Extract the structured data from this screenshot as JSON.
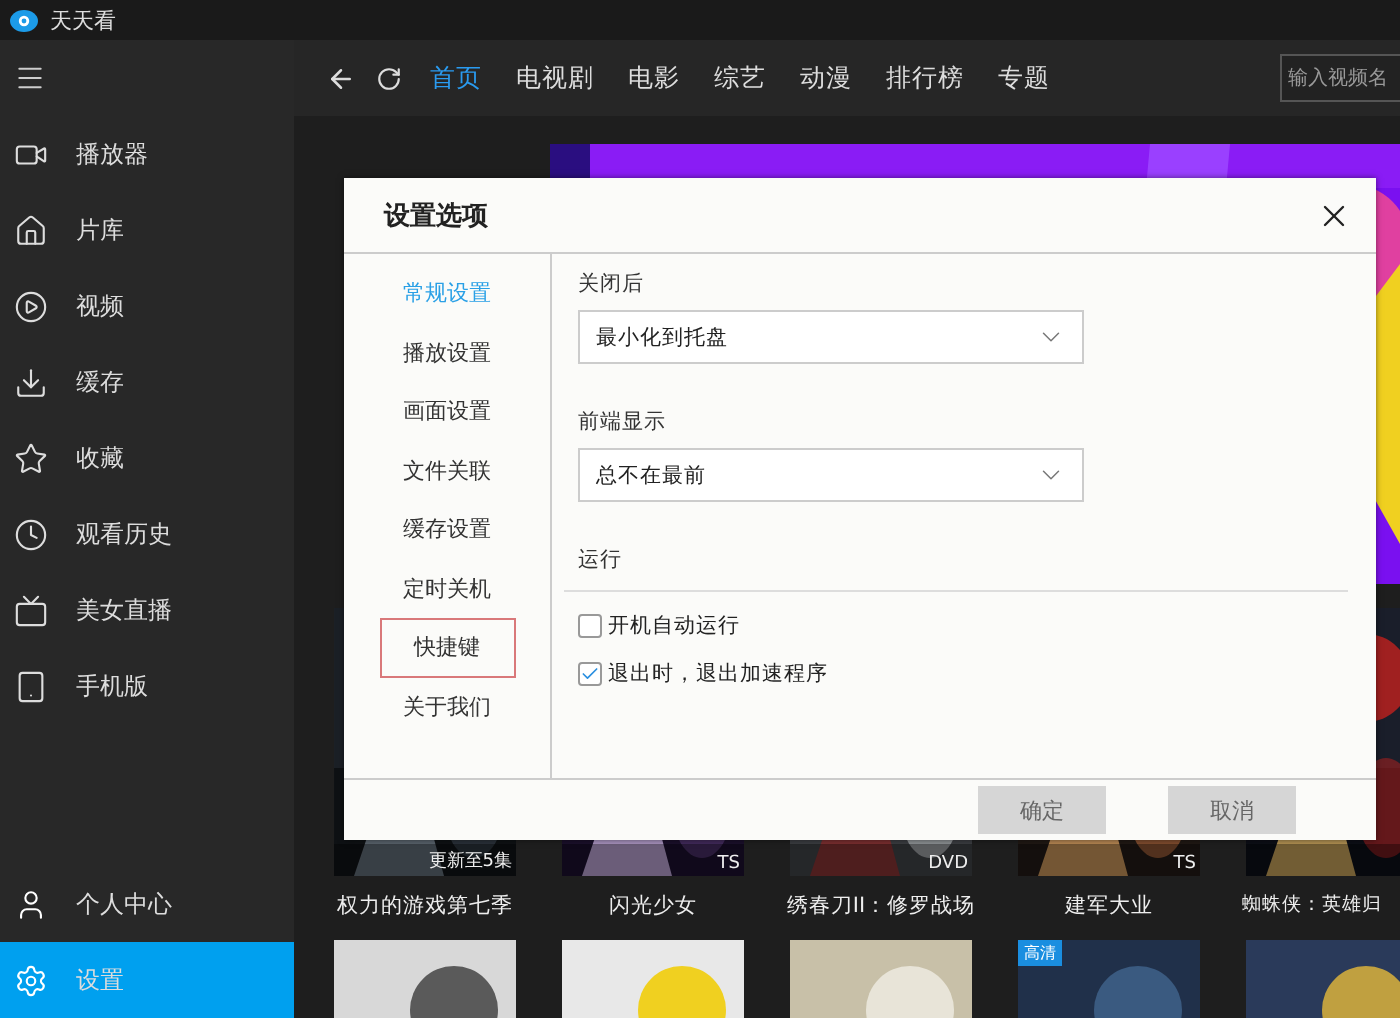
{
  "app": {
    "title": "天天看"
  },
  "sidebar": {
    "items": [
      {
        "label": "播放器",
        "selected": false
      },
      {
        "label": "片库",
        "selected": false
      },
      {
        "label": "视频",
        "selected": false
      },
      {
        "label": "缓存",
        "selected": false
      },
      {
        "label": "收藏",
        "selected": false
      },
      {
        "label": "观看历史",
        "selected": false
      },
      {
        "label": "美女直播",
        "selected": false
      },
      {
        "label": "手机版",
        "selected": false
      }
    ],
    "bottom_items": [
      {
        "label": "个人中心",
        "selected": false
      },
      {
        "label": "设置",
        "selected": true
      }
    ]
  },
  "nav": {
    "tabs": [
      {
        "label": "首页",
        "selected": true
      },
      {
        "label": "电视剧",
        "selected": false
      },
      {
        "label": "电影",
        "selected": false
      },
      {
        "label": "综艺",
        "selected": false
      },
      {
        "label": "动漫",
        "selected": false
      },
      {
        "label": "排行榜",
        "selected": false
      },
      {
        "label": "专题",
        "selected": false
      }
    ],
    "search": {
      "placeholder": "输入视频名"
    }
  },
  "posters": [
    {
      "title": "权力的游戏第七季",
      "tag": "更新至5集"
    },
    {
      "title": "闪光少女",
      "tag": "TS"
    },
    {
      "title": "绣春刀II：修罗战场",
      "tag": "DVD"
    },
    {
      "title": "建军大业",
      "tag": "TS"
    },
    {
      "title": "蜘蛛侠：英雄归"
    }
  ],
  "posters_row_2": [
    {
      "kind": "picture"
    },
    {
      "kind": "picture"
    },
    {
      "kind": "picture"
    },
    {
      "kind": "picture",
      "badge": "高清"
    },
    {
      "kind": "picture"
    }
  ],
  "dialog": {
    "title": "设置选项",
    "nav": [
      {
        "label": "常规设置",
        "selected": true,
        "focused": false
      },
      {
        "label": "播放设置",
        "selected": false,
        "focused": false
      },
      {
        "label": "画面设置",
        "selected": false,
        "focused": false
      },
      {
        "label": "文件关联",
        "selected": false,
        "focused": false
      },
      {
        "label": "缓存设置",
        "selected": false,
        "focused": false
      },
      {
        "label": "定时关机",
        "selected": false,
        "focused": false
      },
      {
        "label": "快捷键",
        "selected": false,
        "focused": true
      },
      {
        "label": "关于我们",
        "selected": false,
        "focused": false
      }
    ],
    "fields": [
      {
        "label": "关闭后",
        "value": "最小化到托盘"
      },
      {
        "label": "前端显示",
        "value": "总不在最前"
      }
    ],
    "section": "运行",
    "checkboxes": [
      {
        "label": "开机自动运行",
        "checked": false
      },
      {
        "label": "退出时，退出加速程序",
        "checked": true
      }
    ],
    "buttons": [
      "确定",
      "取消"
    ]
  }
}
